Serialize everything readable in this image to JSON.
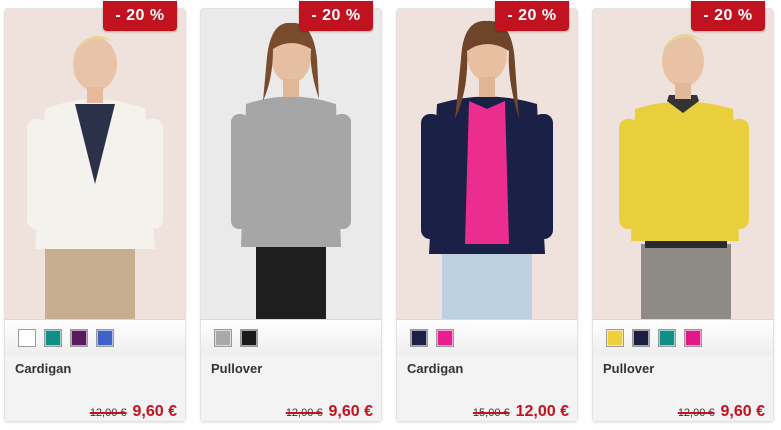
{
  "colors": {
    "accent": "#c1121f",
    "card_bg": "#f3f3f3",
    "text": "#333333"
  },
  "products": [
    {
      "badge": "- 20 %",
      "name": "Cardigan",
      "old_price": "12,00 €",
      "new_price": "9,60 €",
      "swatches": [
        "#ffffff",
        "#0f8f86",
        "#5c1a5e",
        "#3f63c6"
      ],
      "image_alt": "woman wearing white cardigan"
    },
    {
      "badge": "- 20 %",
      "name": "Pullover",
      "old_price": "12,00 €",
      "new_price": "9,60 €",
      "swatches": [
        "#a9a9a9",
        "#1a1a1a"
      ],
      "image_alt": "woman wearing grey pullover"
    },
    {
      "badge": "- 20 %",
      "name": "Cardigan",
      "old_price": "15,00 €",
      "new_price": "12,00 €",
      "swatches": [
        "#1d2048",
        "#ea1d8e"
      ],
      "image_alt": "woman wearing navy cardigan"
    },
    {
      "badge": "- 20 %",
      "name": "Pullover",
      "old_price": "12,00 €",
      "new_price": "9,60 €",
      "swatches": [
        "#f1cf3a",
        "#1c1f40",
        "#0f8f86",
        "#e3178a"
      ],
      "image_alt": "woman wearing yellow pullover"
    }
  ]
}
